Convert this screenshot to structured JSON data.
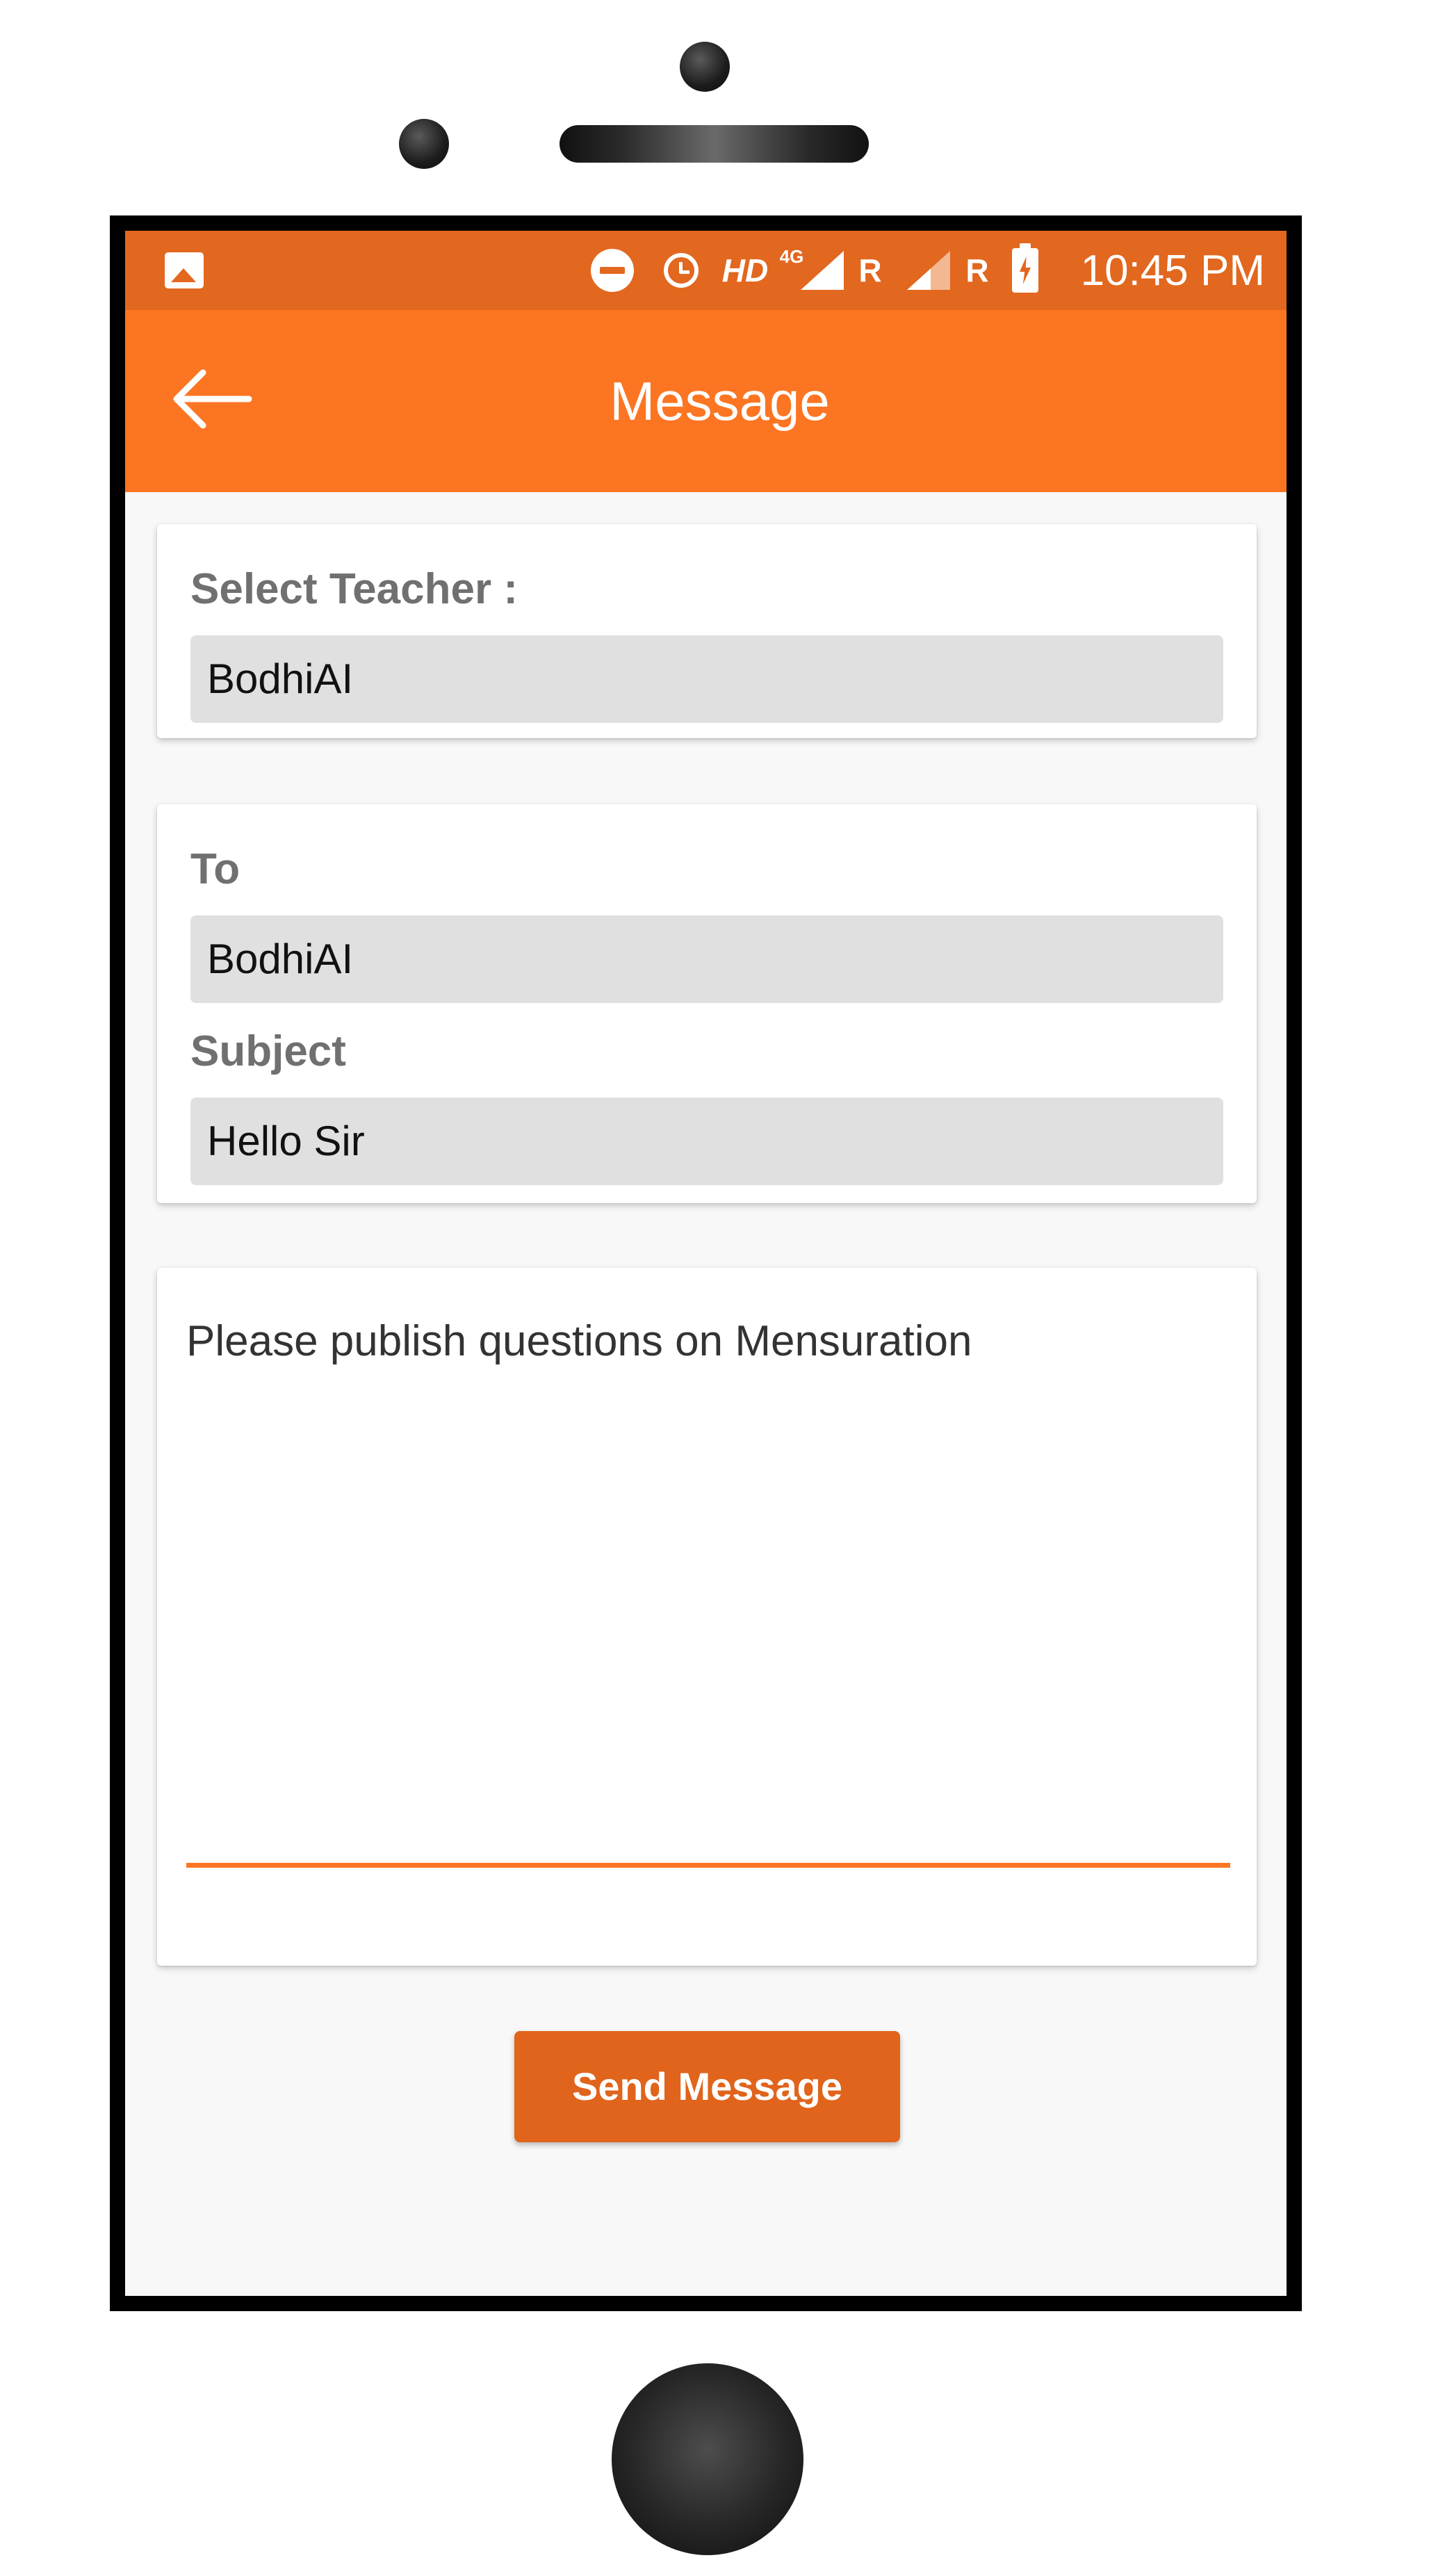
{
  "status_bar": {
    "network_label": "HD",
    "network_type": "4G",
    "roaming1": "R",
    "roaming2": "R",
    "time": "10:45 PM",
    "icons": [
      "image-icon",
      "do-not-disturb-icon",
      "alarm-icon",
      "signal-icon",
      "signal-icon",
      "battery-charging-icon"
    ]
  },
  "app_bar": {
    "title": "Message",
    "back_icon": "arrow-left-icon"
  },
  "teacher_section": {
    "label": "Select Teacher :",
    "value": "BodhiAI"
  },
  "recipient_section": {
    "to_label": "To",
    "to_value": "BodhiAI",
    "subject_label": "Subject",
    "subject_value": "Hello Sir"
  },
  "message_section": {
    "body": "Please publish questions on Mensuration"
  },
  "actions": {
    "send_label": "Send Message"
  },
  "colors": {
    "status_bar": "#e2671f",
    "app_bar": "#fc7522",
    "button": "#e0641c"
  }
}
